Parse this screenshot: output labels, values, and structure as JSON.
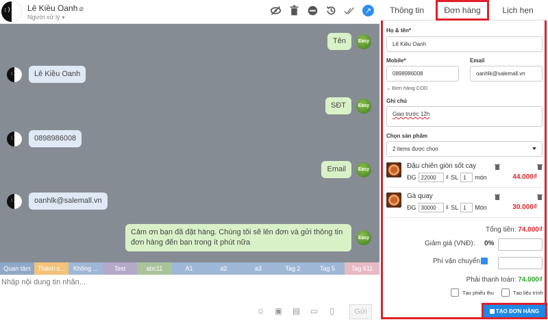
{
  "chat": {
    "contact_name": "Lê Kiều Oanh",
    "handler_label": "Người xử lý",
    "avatar_face": ":)",
    "messages": [
      {
        "side": "out",
        "text": "Tên"
      },
      {
        "side": "in",
        "text": "Lê Kiều Oanh"
      },
      {
        "side": "out",
        "text": "SĐT"
      },
      {
        "side": "in",
        "text": "0898986008"
      },
      {
        "side": "out",
        "text": "Email"
      },
      {
        "side": "in",
        "text": "oanhlk@salemall.vn"
      },
      {
        "side": "out",
        "text": "Cảm ơn bạn đã đặt hàng. Chúng tôi sẽ lên đơn và gửi thông tin đơn hàng đến bạn trong ít phút nữa"
      }
    ],
    "bot_badge": "Easy",
    "tags": [
      {
        "label": "Quan tâm",
        "color": "#8fa8c8"
      },
      {
        "label": "Thành c...",
        "color": "#f3c37a"
      },
      {
        "label": "Không ...",
        "color": "#9fb7d6"
      },
      {
        "label": "Test",
        "color": "#b3a9c9"
      },
      {
        "label": "abc11",
        "color": "#a9c49a"
      },
      {
        "label": "A1",
        "color": "#9fb7d6"
      },
      {
        "label": "a2",
        "color": "#9fb7d6"
      },
      {
        "label": "a3",
        "color": "#9fb7d6"
      },
      {
        "label": "Tag 2",
        "color": "#9fb7d6"
      },
      {
        "label": "Tag 5",
        "color": "#9fb7d6"
      },
      {
        "label": "Tag 611",
        "color": "#e7b9c5"
      }
    ],
    "composer_placeholder": "Nhập nội dung tin nhắn...",
    "send_label": "Gửi"
  },
  "panel": {
    "tabs": [
      "Thông tin",
      "Đơn hàng",
      "Lịch hẹn"
    ],
    "active_tab": "Đơn hàng",
    "name_label": "Họ & tên*",
    "name_value": "Lê Kiều Oanh",
    "mobile_label": "Mobile*",
    "mobile_value": "0898986008",
    "email_label": "Email",
    "email_value": "oanhlk@salemall.vn",
    "cod_label": "Đơn hàng COD",
    "note_label": "Ghi chú",
    "note_value": "Giao trước 12h",
    "product_select_label": "Chọn sản phẩm",
    "product_select_value": "2 items được chọn",
    "products": [
      {
        "name": "Đậu chiên giòn sốt cay",
        "price_label": "ĐG",
        "price": "22000",
        "currency": "₫",
        "qty_label": "SL",
        "qty": "1",
        "unit": "món",
        "total": "44.000₫"
      },
      {
        "name": "Gà quay",
        "price_label": "ĐG",
        "price": "30000",
        "currency": "₫",
        "qty_label": "SL",
        "qty": "1",
        "unit": "Món",
        "total": "30.000₫"
      }
    ],
    "total_label": "Tổng tiền:",
    "total_value": "74.000₫",
    "discount_label": "Giảm giá (VNĐ):",
    "discount_pct": "0%",
    "shipping_label": "Phí vận chuyển:",
    "pay_label": "Phải thanh toán:",
    "pay_value": "74.000₫",
    "receipt_label": "Tạo phiếu thu",
    "schedule_label": "Tạo liệu trình",
    "create_button": "TẠO ĐƠN HÀNG"
  }
}
